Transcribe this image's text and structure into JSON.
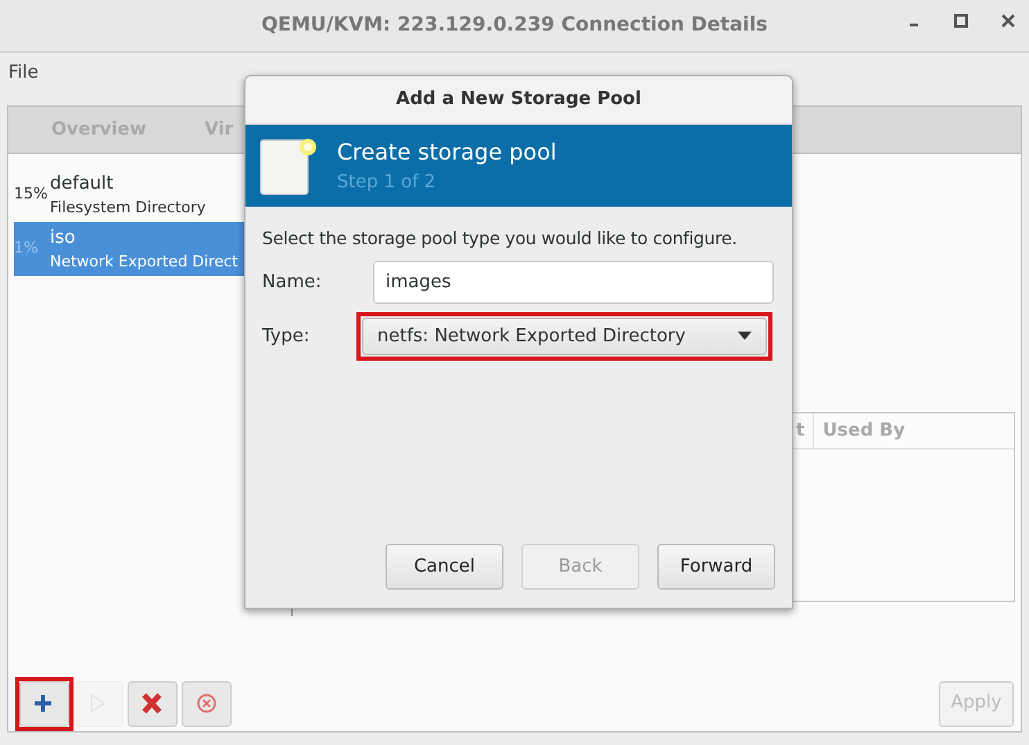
{
  "window": {
    "title": "QEMU/KVM: 223.129.0.239 Connection Details"
  },
  "menu": [
    "File"
  ],
  "tabs": [
    {
      "label": "Overview",
      "selected": false
    },
    {
      "label": "Vir",
      "selected": false
    }
  ],
  "pools": [
    {
      "usage": "15%",
      "name": "default",
      "type": "Filesystem Directory",
      "selected": false
    },
    {
      "usage": "1%",
      "name": "iso",
      "type": "Network Exported Direct",
      "selected": true
    }
  ],
  "volumes_table": {
    "columns": [
      "t",
      "Used By"
    ]
  },
  "toolbar": [
    {
      "kind": "add",
      "disabled": false,
      "highlight": true
    },
    {
      "kind": "start",
      "disabled": true,
      "highlight": false
    },
    {
      "kind": "delete",
      "disabled": false,
      "highlight": false
    },
    {
      "kind": "stop",
      "disabled": false,
      "highlight": false
    }
  ],
  "apply_button": {
    "label": "Apply",
    "disabled": true
  },
  "dialog": {
    "title": "Add a New Storage Pool",
    "header": "Create storage pool",
    "step": "Step 1 of 2",
    "prompt": "Select the storage pool type you would like to configure.",
    "name_label": "Name:",
    "name_value": "images",
    "type_label": "Type:",
    "type_value": "netfs: Network Exported Directory",
    "type_highlight": true,
    "buttons": [
      {
        "label": "Cancel",
        "disabled": false
      },
      {
        "label": "Back",
        "disabled": true
      },
      {
        "label": "Forward",
        "disabled": false
      }
    ]
  }
}
